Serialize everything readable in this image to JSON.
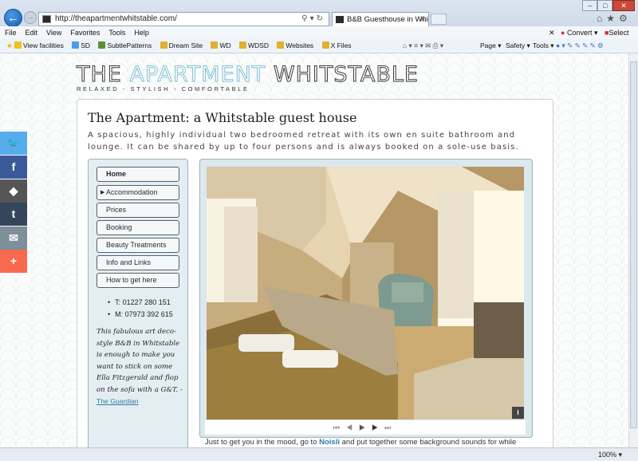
{
  "browser": {
    "url": "http://theapartmentwhitstable.com/",
    "tab_title": "B&B Guesthouse in Whitsta...",
    "menu": [
      "File",
      "Edit",
      "View",
      "Favorites",
      "Tools",
      "Help"
    ],
    "convert_label": "Convert",
    "select_label": "Select",
    "favorites": [
      "View facilities",
      "SD",
      "SubtlePatterns",
      "Dream Site",
      "WD",
      "WDSD",
      "Websites",
      "X Files"
    ],
    "commands": [
      "Page",
      "Safety",
      "Tools"
    ],
    "zoom": "100%"
  },
  "site": {
    "logo": {
      "part1": "THE",
      "part2": "APARTMENT",
      "part3": "WHITSTABLE"
    },
    "tagline": "RELAXED - STYLISH - COMFORTABLE",
    "heading": "The Apartment: a Whitstable guest house",
    "intro": "A spacious, highly individual two bedroomed retreat with its own en suite bathroom and lounge. It can be shared by up to four persons and is always booked on a sole-use basis.",
    "nav": [
      "Home",
      "Accommodation",
      "Prices",
      "Booking",
      "Beauty Treatments",
      "Info and Links",
      "How to get here"
    ],
    "phones": [
      "T: 01227 280 151",
      "M: 07973 392 615"
    ],
    "quote": "This fabulous art deco-style B&B in Whitstable is enough to make you want to stick on some Ella Fitzgerald and flop on the sofa with a G&T. -",
    "quote_source": "The Guardian",
    "slideshow_info": "i",
    "body_before": "Just to get you in the mood, go to ",
    "body_link": "Noisli",
    "body_after": " and put together some background sounds for while"
  },
  "colors": {
    "accent": "#7fc0d4",
    "link": "#2a7ea3",
    "twitter": "#55acee",
    "facebook": "#3b5998",
    "tumblr": "#35465c",
    "email": "#7d8f99",
    "more": "#f8694d"
  },
  "icons": [
    "back-arrow-icon",
    "forward-arrow-icon",
    "home-icon",
    "star-icon",
    "gear-icon",
    "twitter-icon",
    "facebook-icon",
    "evernote-icon",
    "tumblr-icon",
    "email-icon",
    "plus-icon"
  ]
}
